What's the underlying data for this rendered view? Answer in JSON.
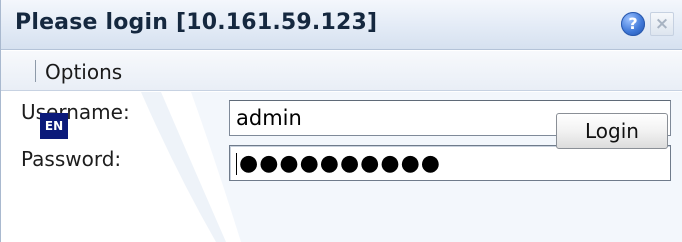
{
  "window": {
    "title": "Please login [10.161.59.123]",
    "help_icon": "question-mark-icon",
    "help_glyph": "?",
    "close_icon": "close-x-icon",
    "close_glyph": "×",
    "colors": {
      "titlebar_top": "#f4f7fc",
      "titlebar_bottom": "#d6e1f0",
      "title_text": "#15283f",
      "help_blue": "#3f78d8"
    }
  },
  "menu": {
    "items": [
      {
        "label": "Options"
      }
    ]
  },
  "form": {
    "username": {
      "label": "Username:",
      "value": "admin"
    },
    "password": {
      "label": "Password:",
      "masked_value": "●●●●●●●●●●"
    },
    "language": {
      "label": "EN",
      "color": "#0b1a7a"
    },
    "login_button": {
      "label": "Login"
    }
  }
}
